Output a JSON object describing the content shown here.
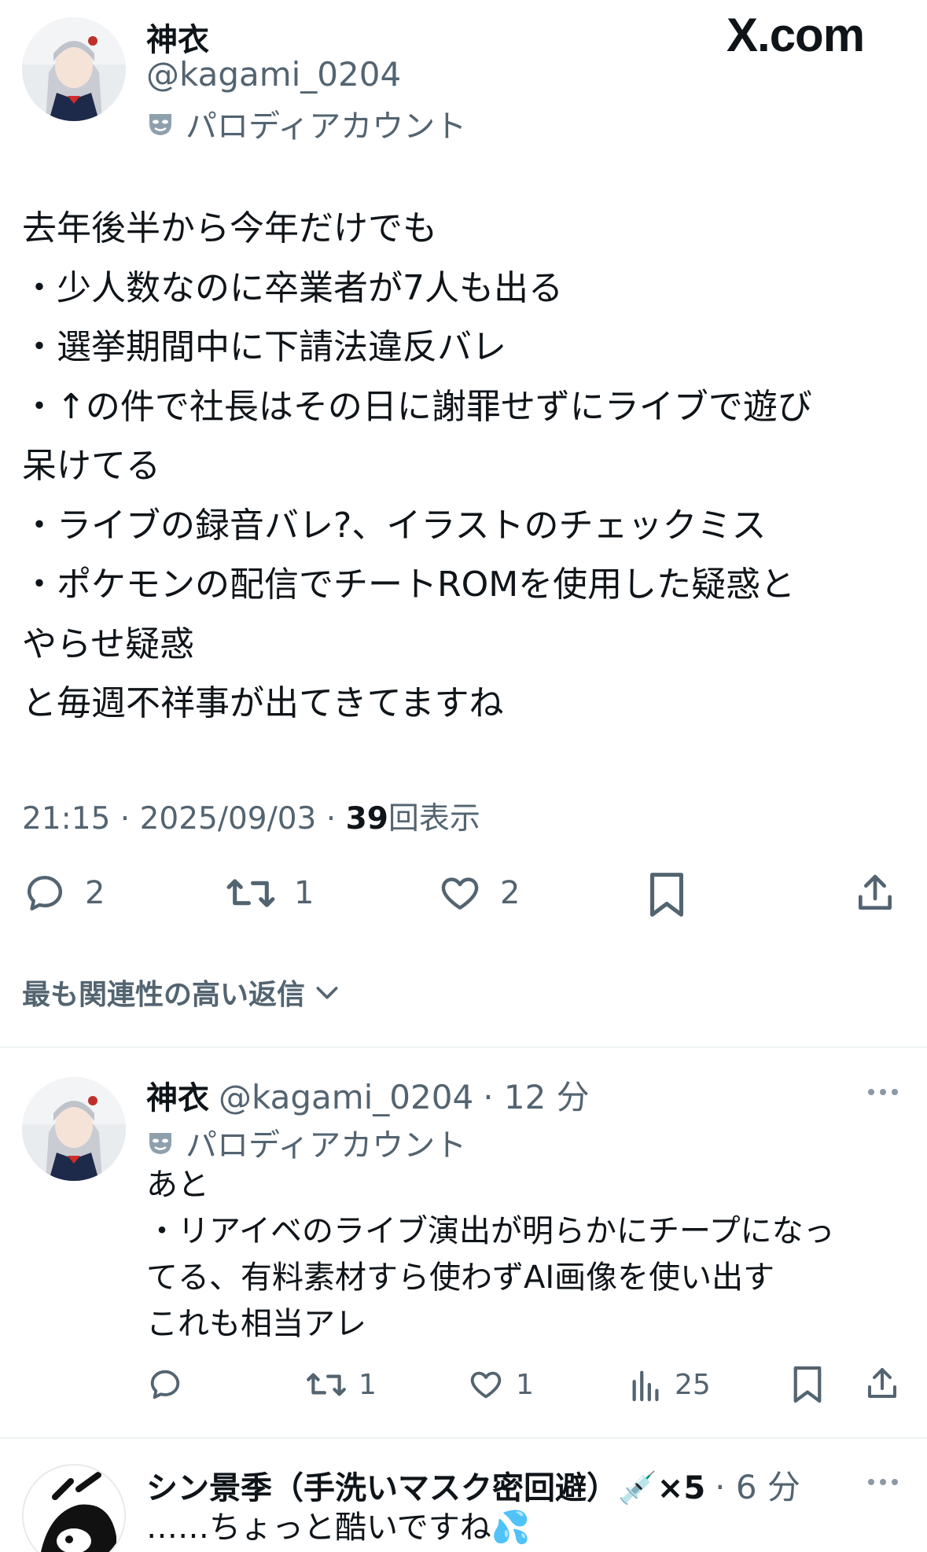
{
  "brand": "X.com",
  "main_tweet": {
    "author": {
      "name": "神衣",
      "handle": "@kagami_0204",
      "label": "パロディアカウント"
    },
    "text_lines": [
      "去年後半から今年だけでも",
      "・少人数なのに卒業者が7人も出る",
      "・選挙期間中に下請法違反バレ",
      "・↑の件で社長はその日に謝罪せずにライブで遊び",
      "呆けてる",
      "・ライブの録音バレ?、イラストのチェックミス",
      "・ポケモンの配信でチートROMを使用した疑惑と",
      "やらせ疑惑",
      "と毎週不祥事が出てきてますね"
    ],
    "timestamp": "21:15 · 2025/09/03 · ",
    "views_count": "39",
    "views_label": "回表示",
    "actions": {
      "replies": "2",
      "reposts": "1",
      "likes": "2"
    }
  },
  "sort_label": "最も関連性の高い返信",
  "replies": [
    {
      "name": "神衣",
      "handle": "@kagami_0204",
      "time": "· 12 分",
      "label": "パロディアカウント",
      "text_lines": [
        "あと",
        "・リアイベのライブ演出が明らかにチープになっ",
        "てる、有料素材すら使わずAI画像を使い出す",
        "これも相当アレ"
      ],
      "actions": {
        "replies": "",
        "reposts": "1",
        "likes": "1",
        "views": "25"
      }
    },
    {
      "name": "シン景季（手洗いマスク密回避）💉×5",
      "time": "· 6 分",
      "text": "……ちょっと酷いですね💦"
    }
  ],
  "colors": {
    "text": "#0f1419",
    "secondary": "#536471",
    "divider": "#eff3f4"
  }
}
